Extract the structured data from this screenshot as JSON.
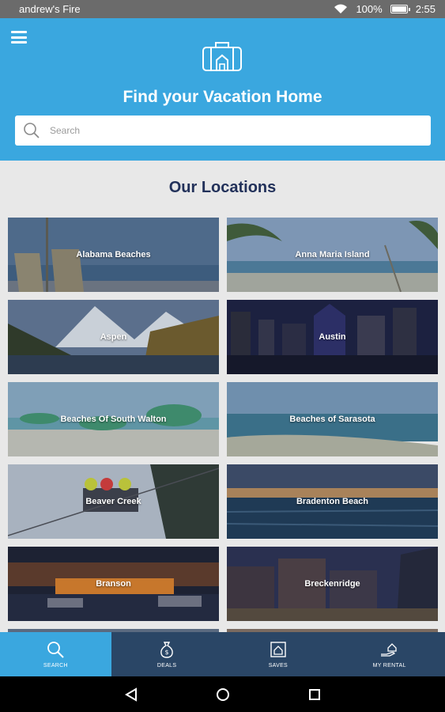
{
  "status_bar": {
    "carrier": "andrew's Fire",
    "battery": "100%",
    "time": "2:55",
    "battery_level": 1.0
  },
  "header": {
    "title": "Find your Vacation Home",
    "search_placeholder": "Search",
    "background_color": "#3aa7df"
  },
  "section_title": "Our Locations",
  "locations": [
    {
      "label": "Alabama Beaches",
      "scene": "beach-chairs"
    },
    {
      "label": "Anna Maria Island",
      "scene": "palm-beach"
    },
    {
      "label": "Aspen",
      "scene": "mountain-lake"
    },
    {
      "label": "Austin",
      "scene": "city-night"
    },
    {
      "label": "Beaches Of South Walton",
      "scene": "umbrellas-beach"
    },
    {
      "label": "Beaches of Sarasota",
      "scene": "shore"
    },
    {
      "label": "Beaver Creek",
      "scene": "ski-lift"
    },
    {
      "label": "Bradenton Beach",
      "scene": "sunset-sea"
    },
    {
      "label": "Branson",
      "scene": "riverboat-night"
    },
    {
      "label": "Breckenridge",
      "scene": "town-night"
    }
  ],
  "bottom_nav": [
    {
      "label": "SEARCH",
      "icon": "search-icon",
      "active": true
    },
    {
      "label": "DEALS",
      "icon": "money-bag-icon",
      "active": false
    },
    {
      "label": "SAVES",
      "icon": "saved-home-icon",
      "active": false
    },
    {
      "label": "MY RENTAL",
      "icon": "hand-house-icon",
      "active": false
    }
  ],
  "colors": {
    "accent": "#3aa7df",
    "nav_bg": "#2a4666",
    "heading": "#22315a"
  }
}
